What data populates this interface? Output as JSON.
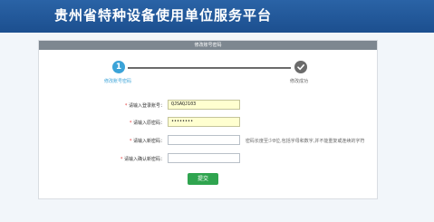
{
  "header": {
    "title": "贵州省特种设备使用单位服务平台"
  },
  "panel": {
    "title": "修改账号密码"
  },
  "steps": [
    {
      "number": "1",
      "label": "修改账号密码",
      "status": "active"
    },
    {
      "icon": "checkmark-icon",
      "label": "修改成功",
      "status": "pending"
    }
  ],
  "form": {
    "fields": [
      {
        "label": "请输入登录账号：",
        "required": true,
        "value": "QJSAQJ103"
      },
      {
        "label": "请输入原密码：",
        "required": true,
        "value": "••••••••"
      },
      {
        "label": "请输入新密码：",
        "required": true,
        "value": "",
        "hint": "密码长度至少8位,包括字母和数字,并不能重复或连续的字符"
      },
      {
        "label": "请输入确认新密码：",
        "required": true,
        "value": ""
      }
    ],
    "submit_label": "提交"
  },
  "colors": {
    "banner": "#1f5494",
    "active_step": "#3ba3d8",
    "pending_step": "#6b6b6b",
    "submit": "#2fa44f",
    "filled_field": "#ffffd0"
  }
}
